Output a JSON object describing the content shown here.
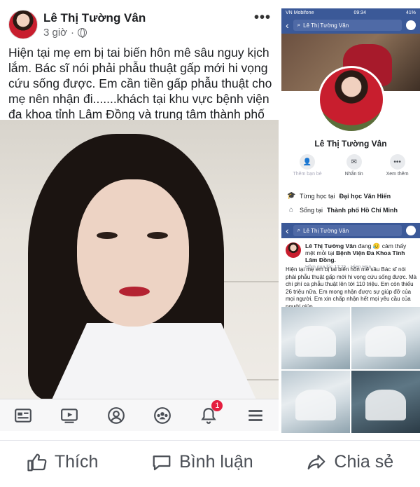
{
  "post": {
    "author": "Lê Thị Tường Vân",
    "time": "3 giờ",
    "more": "•••",
    "text": "Hiện tại mẹ em bị tai biến hôn mê sâu nguy kịch lắm. Bác sĩ nói phải phẫu thuật gấp mới hi vọng cứu sống được. Em cần tiền gấp phẫu thuật cho mẹ nên nhận đi.......khách tại khu vực bệnh viện đa khoa tỉnh Lâm Đồng và trung tâm thành phố Đà Lạt."
  },
  "bottom_nav": {
    "items": [
      "news-feed",
      "watch",
      "profile",
      "groups",
      "notifications",
      "menu"
    ],
    "notification_count": "1"
  },
  "profile_screen": {
    "status_carrier": "VN Mobifone",
    "status_time": "09:34",
    "status_battery": "41%",
    "search_text": "Lê Thị Tường Vân",
    "name": "Lê Thị Tường Vân",
    "actions": [
      {
        "label": "Thêm bạn bè",
        "icon": "add-friend-icon"
      },
      {
        "label": "Nhắn tin",
        "icon": "messenger-icon"
      },
      {
        "label": "Xem thêm",
        "icon": "more-icon"
      }
    ],
    "studied_prefix": "Từng học tại",
    "studied_value": "Đại học Văn Hiến",
    "lives_prefix": "Sống tại",
    "lives_value": "Thành phố Hồ Chí Minh"
  },
  "post_screen": {
    "search_text": "Lê Thị Tường Vân",
    "author": "Lê Thị Tường Vân",
    "feeling": "đang 😥 cảm thấy mệt mỏi tại",
    "place": "Bệnh Viện Đa Khoa Tỉnh Lâm Đồng.",
    "meta": "Hôm qua lúc 17:21 · Hiep Hoa ·",
    "text": "Hiện tại mẹ em bị tai biến hôn mê sâu Bác sĩ nói phải phẫu thuật gấp mới hi vọng cứu sống được. Mà chi phí ca phẫu thuật lên tới 110 triệu. Em còn thiếu 26 triệu nữa. Em mong nhận được sự giúp đỡ của mọi người. Em xin chấp nhận hết mọi yêu cầu của người giúp"
  },
  "reactions": {
    "like": "Thích",
    "comment": "Bình luận",
    "share": "Chia sẻ"
  },
  "colors": {
    "fb_blue": "#3b5998",
    "badge_red": "#e41e3f",
    "nav_icon": "#4b4f56"
  }
}
